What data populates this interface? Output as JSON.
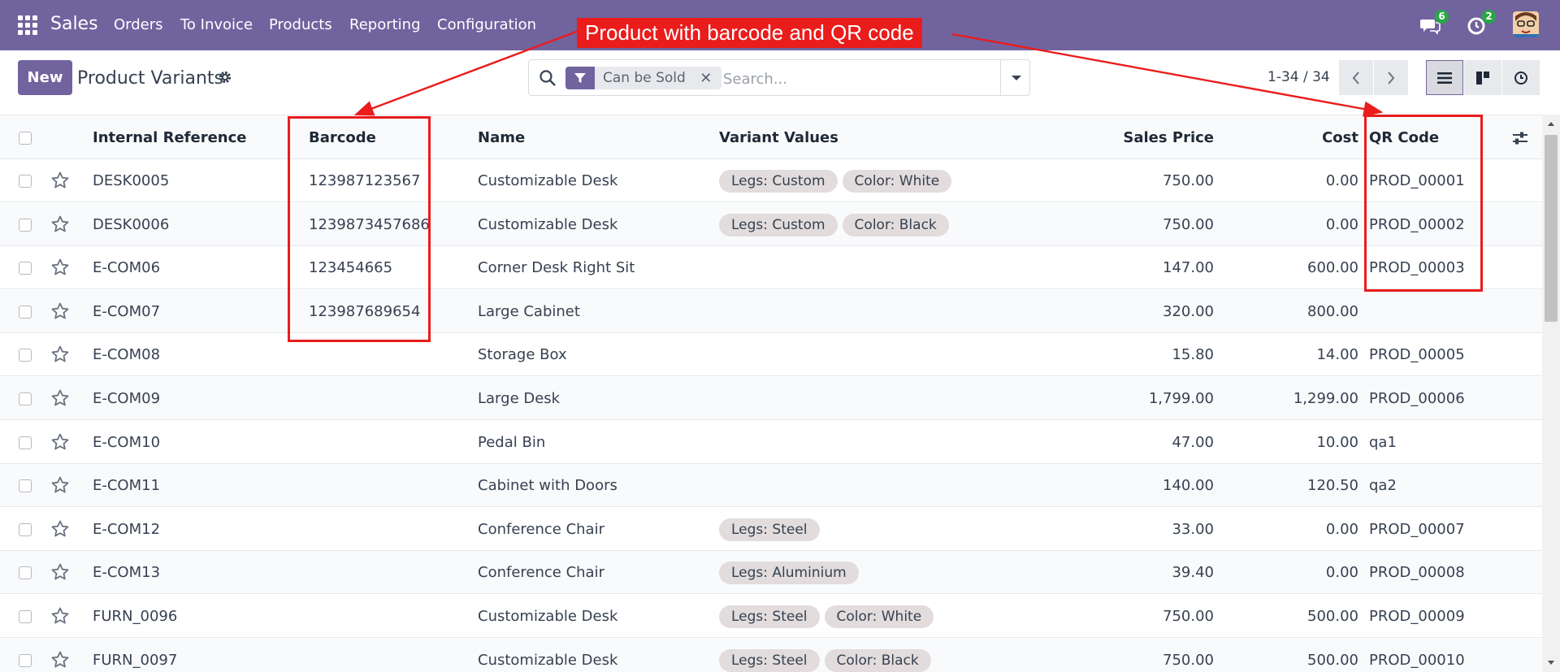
{
  "navbar": {
    "app_name": "Sales",
    "menu": [
      "Orders",
      "To Invoice",
      "Products",
      "Reporting",
      "Configuration"
    ],
    "messages_count": "6",
    "activities_count": "2",
    "accent_color": "#71639e"
  },
  "control": {
    "new_label": "New",
    "title": "Product Variants",
    "facet_label": "Can be Sold",
    "search_placeholder": "Search...",
    "pager": "1-34 / 34"
  },
  "annotation": {
    "label": "Product with barcode and QR code",
    "color": "#ea1c1c"
  },
  "table": {
    "headers": {
      "internal_reference": "Internal Reference",
      "barcode": "Barcode",
      "name": "Name",
      "variant_values": "Variant Values",
      "sales_price": "Sales Price",
      "cost": "Cost",
      "qr_code": "QR Code"
    },
    "rows": [
      {
        "ref": "DESK0005",
        "barcode": "123987123567",
        "name": "Customizable Desk",
        "tags": [
          "Legs: Custom",
          "Color: White"
        ],
        "price": "750.00",
        "cost": "0.00",
        "qr": "PROD_00001"
      },
      {
        "ref": "DESK0006",
        "barcode": "1239873457686",
        "name": "Customizable Desk",
        "tags": [
          "Legs: Custom",
          "Color: Black"
        ],
        "price": "750.00",
        "cost": "0.00",
        "qr": "PROD_00002"
      },
      {
        "ref": "E-COM06",
        "barcode": "123454665",
        "name": "Corner Desk Right Sit",
        "tags": [],
        "price": "147.00",
        "cost": "600.00",
        "qr": "PROD_00003"
      },
      {
        "ref": "E-COM07",
        "barcode": "123987689654",
        "name": "Large Cabinet",
        "tags": [],
        "price": "320.00",
        "cost": "800.00",
        "qr": ""
      },
      {
        "ref": "E-COM08",
        "barcode": "",
        "name": "Storage Box",
        "tags": [],
        "price": "15.80",
        "cost": "14.00",
        "qr": "PROD_00005"
      },
      {
        "ref": "E-COM09",
        "barcode": "",
        "name": "Large Desk",
        "tags": [],
        "price": "1,799.00",
        "cost": "1,299.00",
        "qr": "PROD_00006"
      },
      {
        "ref": "E-COM10",
        "barcode": "",
        "name": "Pedal Bin",
        "tags": [],
        "price": "47.00",
        "cost": "10.00",
        "qr": "qa1"
      },
      {
        "ref": "E-COM11",
        "barcode": "",
        "name": "Cabinet with Doors",
        "tags": [],
        "price": "140.00",
        "cost": "120.50",
        "qr": "qa2"
      },
      {
        "ref": "E-COM12",
        "barcode": "",
        "name": "Conference Chair",
        "tags": [
          "Legs: Steel"
        ],
        "price": "33.00",
        "cost": "0.00",
        "qr": "PROD_00007"
      },
      {
        "ref": "E-COM13",
        "barcode": "",
        "name": "Conference Chair",
        "tags": [
          "Legs: Aluminium"
        ],
        "price": "39.40",
        "cost": "0.00",
        "qr": "PROD_00008"
      },
      {
        "ref": "FURN_0096",
        "barcode": "",
        "name": "Customizable Desk",
        "tags": [
          "Legs: Steel",
          "Color: White"
        ],
        "price": "750.00",
        "cost": "500.00",
        "qr": "PROD_00009"
      },
      {
        "ref": "FURN_0097",
        "barcode": "",
        "name": "Customizable Desk",
        "tags": [
          "Legs: Steel",
          "Color: Black"
        ],
        "price": "750.00",
        "cost": "500.00",
        "qr": "PROD_00010"
      }
    ]
  }
}
